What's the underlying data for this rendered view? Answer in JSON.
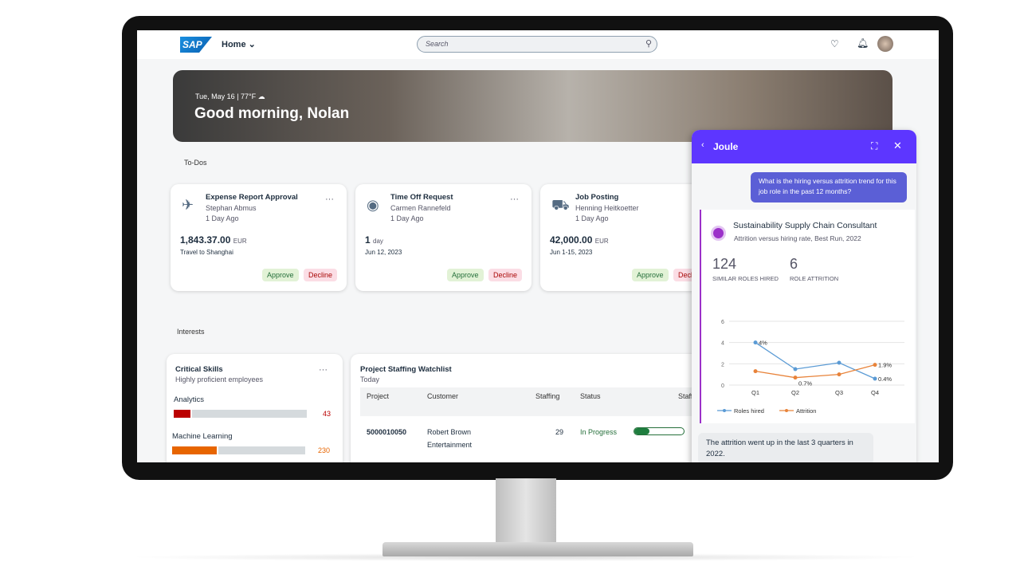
{
  "shell": {
    "logo": "SAP",
    "home": "Home",
    "search_placeholder": "Search"
  },
  "banner": {
    "date": "Tue, May 16 | 77°F",
    "greeting": "Good morning, Nolan"
  },
  "todos": {
    "title": "To-Dos",
    "cards": [
      {
        "icon": "airplane-icon",
        "title": "Expense Report Approval",
        "person": "Stephan Abmus",
        "age": "1 Day Ago",
        "amount": "1,843.37.00",
        "unit": "EUR",
        "detail": "Travel to Shanghai",
        "approve": "Approve",
        "decline": "Decline"
      },
      {
        "icon": "person-icon",
        "title": "Time Off Request",
        "person": "Carmen Rannefeld",
        "age": "1 Day Ago",
        "amount": "1",
        "unit": "day",
        "detail": "Jun 12, 2023",
        "approve": "Approve",
        "decline": "Decline"
      },
      {
        "icon": "truck-icon",
        "title": "Job Posting",
        "person": "Henning Heitkoetter",
        "age": "1 Day Ago",
        "amount": "42,000.00",
        "unit": "EUR",
        "detail": "Jun 1-15, 2023",
        "approve": "Approve",
        "decline": "Decl"
      }
    ]
  },
  "interests": {
    "title": "Interests",
    "skills": {
      "title": "Critical Skills",
      "subtitle": "Highly proficient employees",
      "items": [
        {
          "name": "Analytics",
          "value": "43",
          "fraction": 0.14,
          "color": "#bb0000"
        },
        {
          "name": "Machine Learning",
          "value": "230",
          "fraction": 0.35,
          "color": "#e76500"
        }
      ]
    },
    "staffing": {
      "title": "Project Staffing Watchlist",
      "subtitle": "Today",
      "columns": [
        "Project",
        "Customer",
        "Staffing",
        "Status",
        "Staffi"
      ],
      "rows": [
        {
          "project": "5000010050",
          "customer1": "Robert Brown",
          "customer2": "Entertainment",
          "staffing": "29",
          "status": "In Progress",
          "progress": 0.3,
          "next": "3"
        }
      ]
    }
  },
  "joule": {
    "title": "Joule",
    "question": "What is the hiring versus attrition trend for this job role in the past 12 months?",
    "card_title": "Sustainability Supply Chain Consultant",
    "card_subtitle": "Attrition versus hiring rate, Best Run, 2022",
    "kpi1_value": "124",
    "kpi1_label": "SIMILAR ROLES HIRED",
    "kpi2_value": "6",
    "kpi2_label": "ROLE ATTRITION",
    "reply": "The attrition went up in the last 3 quarters in 2022."
  },
  "chart_data": {
    "type": "line",
    "categories": [
      "Q1",
      "Q2",
      "Q3",
      "Q4"
    ],
    "ylim": [
      0,
      6
    ],
    "yticks": [
      "0",
      "2",
      "4",
      "6"
    ],
    "grid": true,
    "legend": "bottom-left",
    "series": [
      {
        "name": "Roles hired",
        "color": "#5b9bd5",
        "values": [
          4,
          1.5,
          2.1,
          0.6
        ],
        "labels": [
          "4%",
          "",
          "",
          "0.4%"
        ]
      },
      {
        "name": "Attrition",
        "color": "#e8833a",
        "values": [
          1.3,
          0.7,
          1.0,
          1.9
        ],
        "labels": [
          "",
          "0.7%",
          "",
          "1.9%"
        ]
      }
    ]
  }
}
